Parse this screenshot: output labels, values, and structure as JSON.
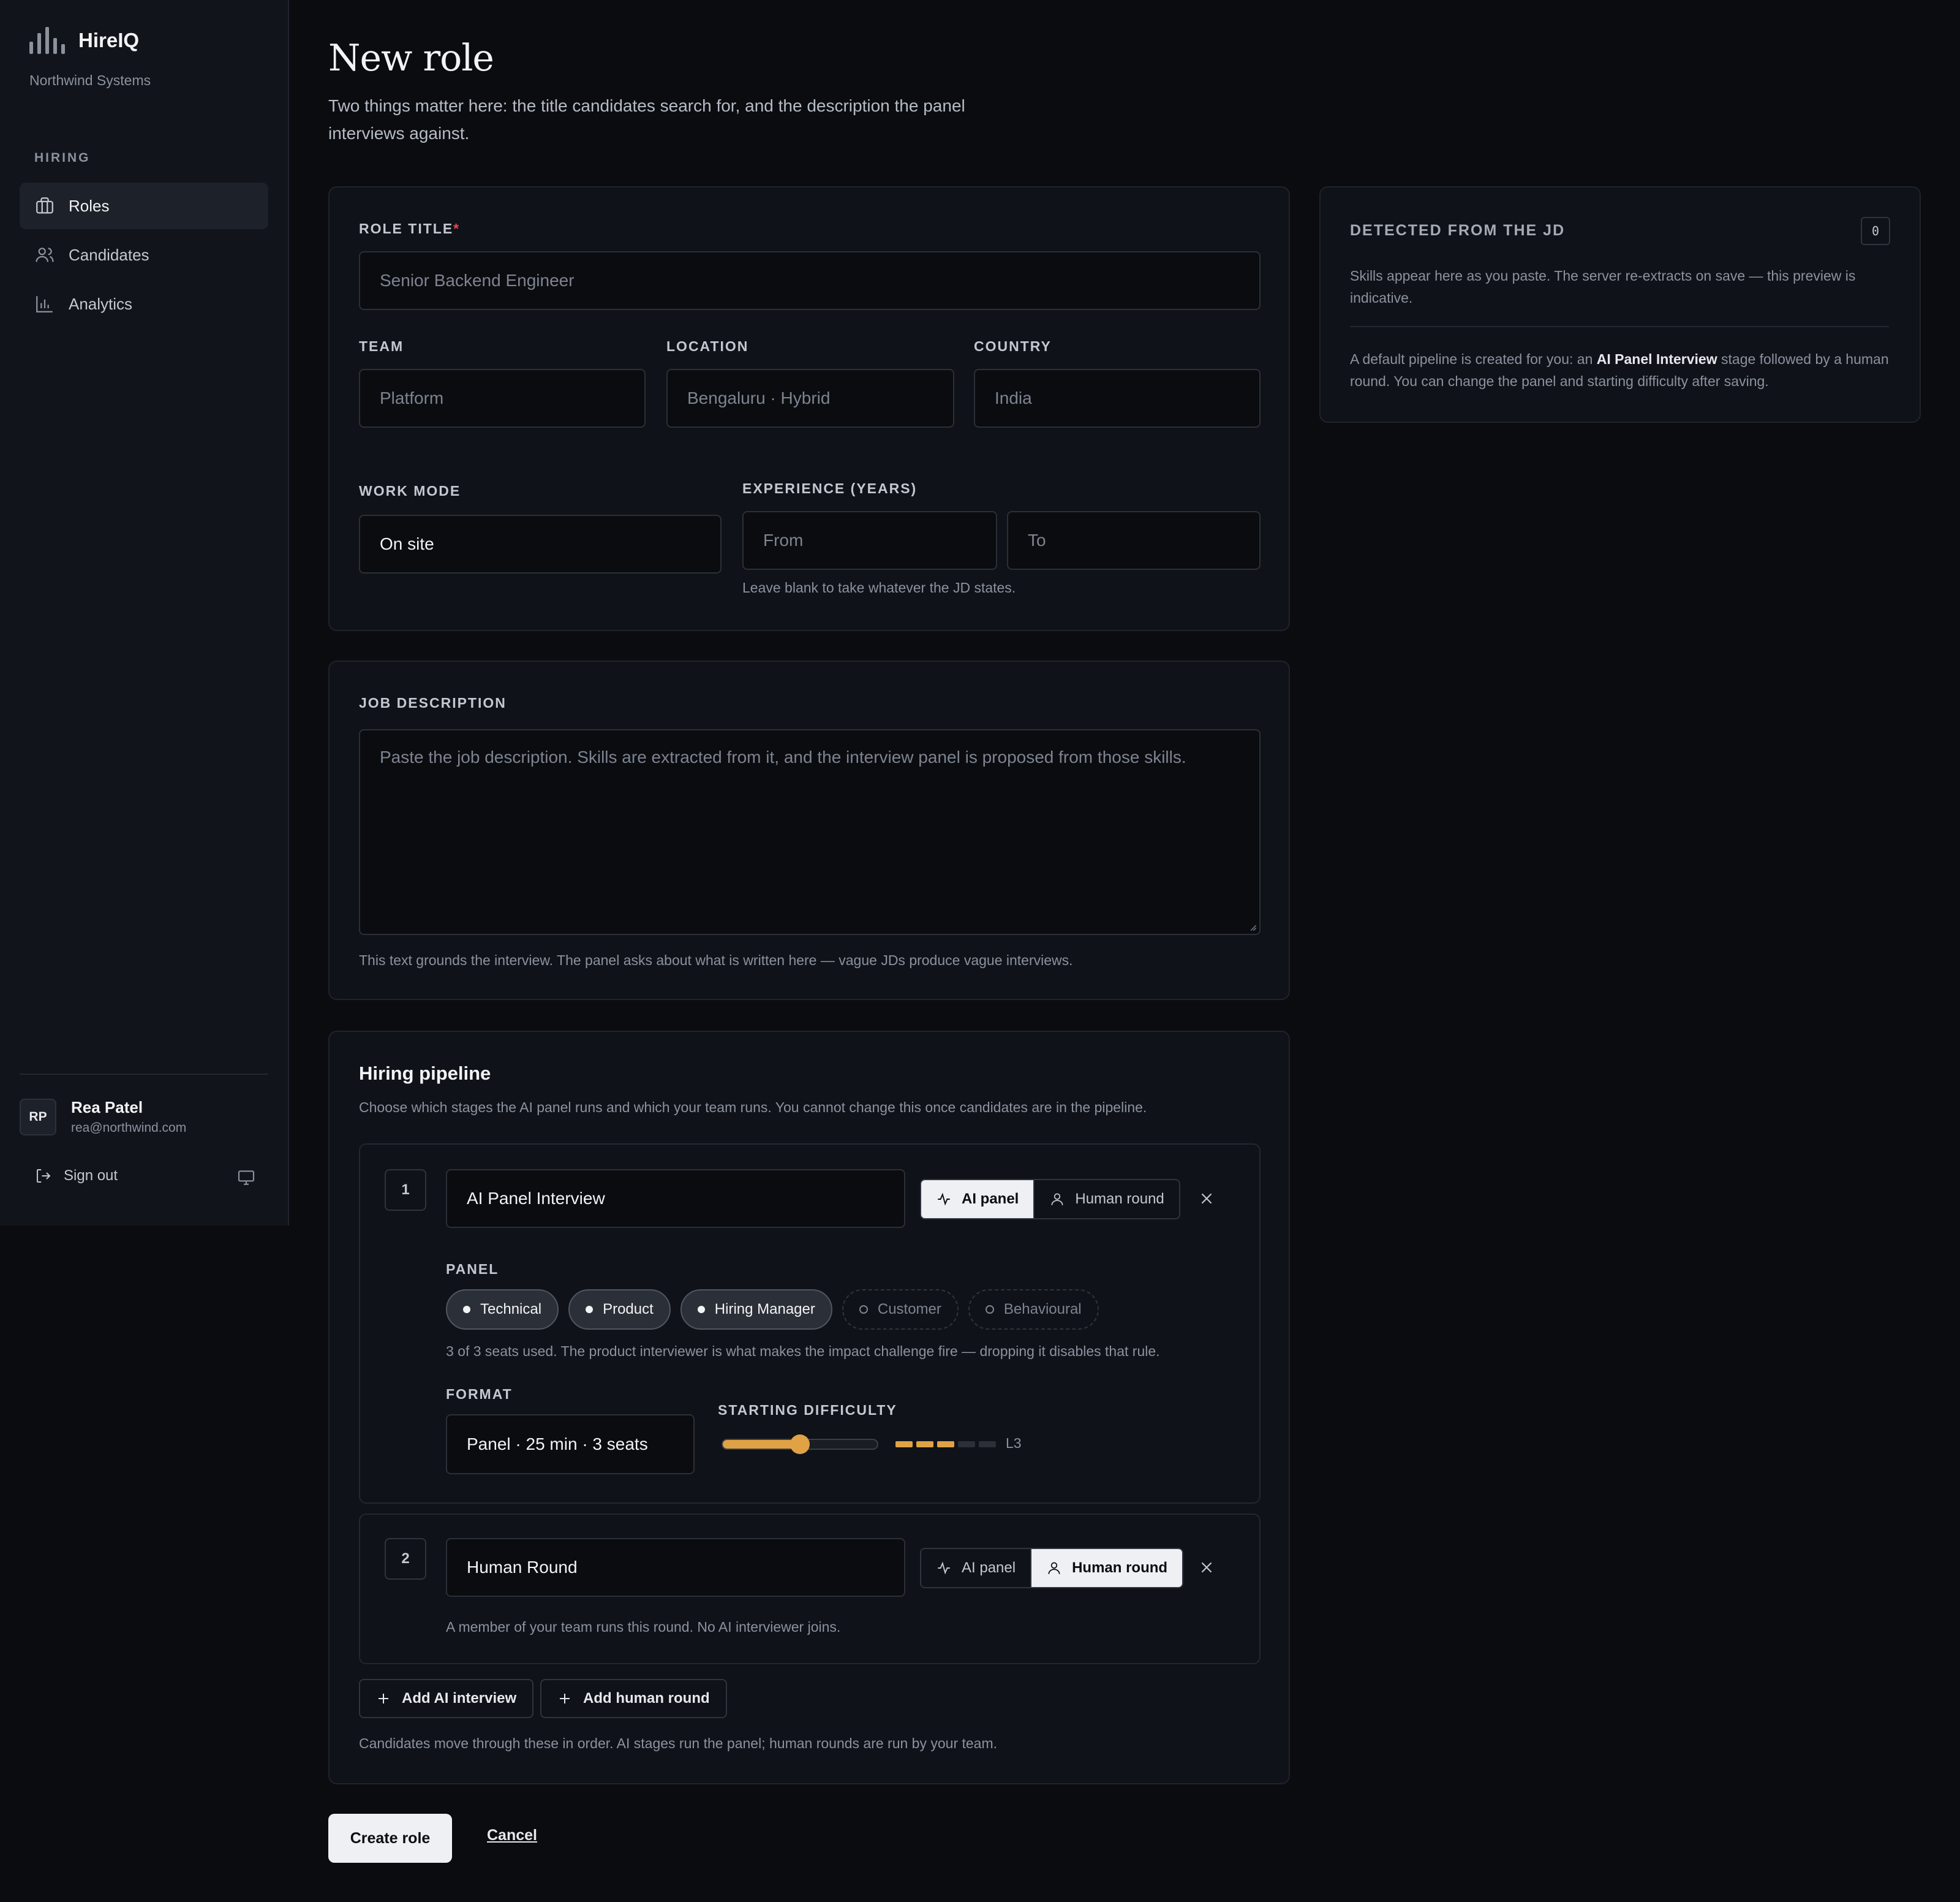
{
  "app": {
    "name": "HireIQ",
    "org": "Northwind Systems"
  },
  "nav": {
    "section": "HIRING",
    "items": [
      {
        "label": "Roles",
        "icon": "briefcase-icon",
        "active": true
      },
      {
        "label": "Candidates",
        "icon": "users-icon",
        "active": false
      },
      {
        "label": "Analytics",
        "icon": "bar-chart-icon",
        "active": false
      }
    ]
  },
  "user": {
    "initials": "RP",
    "name": "Rea Patel",
    "email": "rea@northwind.com",
    "signout": "Sign out"
  },
  "page": {
    "title": "New role",
    "subtitle": "Two things matter here: the title candidates search for, and the description the panel interviews against."
  },
  "role": {
    "title_label": "ROLE TITLE",
    "required_mark": "*",
    "title_placeholder": "Senior Backend Engineer",
    "team_label": "TEAM",
    "team_placeholder": "Platform",
    "location_label": "LOCATION",
    "location_placeholder": "Bengaluru · Hybrid",
    "country_label": "COUNTRY",
    "country_placeholder": "India",
    "work_mode_label": "WORK MODE",
    "work_mode_value": "On site",
    "experience_label": "EXPERIENCE (YEARS)",
    "exp_from_placeholder": "From",
    "exp_to_placeholder": "To",
    "experience_hint": "Leave blank to take whatever the JD states."
  },
  "jd": {
    "label": "JOB DESCRIPTION",
    "placeholder": "Paste the job description. Skills are extracted from it, and the interview panel is proposed from those skills.",
    "hint": "This text grounds the interview. The panel asks about what is written here — vague JDs produce vague interviews."
  },
  "pipeline": {
    "title": "Hiring pipeline",
    "subtitle": "Choose which stages the AI panel runs and which your team runs. You cannot change this once candidates are in the pipeline.",
    "seg_ai": "AI panel",
    "seg_human": "Human round",
    "stages": [
      {
        "num": "1",
        "name": "AI Panel Interview",
        "mode": "ai",
        "panel_label": "PANEL",
        "panel": [
          {
            "label": "Technical",
            "on": true
          },
          {
            "label": "Product",
            "on": true
          },
          {
            "label": "Hiring Manager",
            "on": true
          },
          {
            "label": "Customer",
            "on": false
          },
          {
            "label": "Behavioural",
            "on": false
          }
        ],
        "panel_hint": "3 of 3 seats used. The product interviewer is what makes the impact challenge fire — dropping it disables that rule.",
        "format_label": "FORMAT",
        "format_value": "Panel · 25 min · 3 seats",
        "difficulty_label": "STARTING DIFFICULTY",
        "difficulty_level": 3,
        "difficulty_max": 5,
        "difficulty_text": "L3"
      },
      {
        "num": "2",
        "name": "Human Round",
        "mode": "human",
        "hint": "A member of your team runs this round. No AI interviewer joins."
      }
    ],
    "add_ai": "Add AI interview",
    "add_human": "Add human round",
    "footer": "Candidates move through these in order. AI stages run the panel; human rounds are run by your team."
  },
  "detected": {
    "title": "DETECTED FROM THE JD",
    "count": "0",
    "text1": "Skills appear here as you paste. The server re-extracts on save — this preview is indicative.",
    "text2_pre": "A default pipeline is created for you: an ",
    "text2_bold": "AI Panel Interview",
    "text2_post": " stage followed by a human round. You can change the panel and starting difficulty after saving."
  },
  "actions": {
    "create": "Create role",
    "cancel": "Cancel"
  },
  "colors": {
    "accent": "#e0a244",
    "required": "#e5484d",
    "bg": "#0a0c10"
  }
}
